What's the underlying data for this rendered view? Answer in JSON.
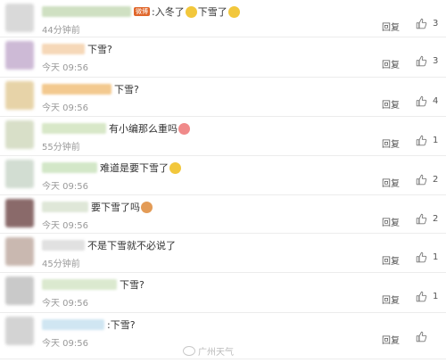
{
  "comments": [
    {
      "segments": [
        ":入冬了",
        "下雪了"
      ],
      "time": "44分钟前",
      "reply": "回复",
      "likes": "3",
      "badge": "微博",
      "emojis": [
        "#f2c73c",
        "#f2c73c"
      ],
      "uname_w": 100,
      "uname_col": "#cfe0c2",
      "avatar_col": "#d9d9d9"
    },
    {
      "segments": [
        "下雪?"
      ],
      "time": "今天 09:56",
      "reply": "回复",
      "likes": "3",
      "emojis": [],
      "uname_w": 48,
      "uname_col": "#f6d8b8",
      "avatar_col": "#cdbad6"
    },
    {
      "segments": [
        "下雪?"
      ],
      "time": "今天 09:56",
      "reply": "回复",
      "likes": "4",
      "emojis": [],
      "uname_w": 78,
      "uname_col": "#f3c98f",
      "avatar_col": "#e7d3a8"
    },
    {
      "segments": [
        "有小编那么重吗"
      ],
      "time": "55分钟前",
      "reply": "回复",
      "likes": "1",
      "emojis": [
        "#f08a8a"
      ],
      "uname_w": 72,
      "uname_col": "#d8e8c8",
      "avatar_col": "#d8dfc8"
    },
    {
      "segments": [
        "难道是要下雪了"
      ],
      "time": "今天 09:56",
      "reply": "回复",
      "likes": "2",
      "emojis": [
        "#f2c73c"
      ],
      "uname_w": 62,
      "uname_col": "#d3e7c8",
      "avatar_col": "#d2ddd2"
    },
    {
      "segments": [
        "要下雪了吗"
      ],
      "time": "今天 09:56",
      "reply": "回复",
      "likes": "2",
      "emojis": [
        "#e39b56"
      ],
      "uname_w": 52,
      "uname_col": "#dfe7d8",
      "avatar_col": "#8a6a6a"
    },
    {
      "segments": [
        "不是下雪就不必说了"
      ],
      "time": "45分钟前",
      "reply": "回复",
      "likes": "1",
      "emojis": [],
      "uname_w": 48,
      "uname_col": "#e1e1e1",
      "avatar_col": "#c9b8b0"
    },
    {
      "segments": [
        "下雪?"
      ],
      "time": "今天 09:56",
      "reply": "回复",
      "likes": "1",
      "emojis": [],
      "uname_w": 84,
      "uname_col": "#dbe9cf",
      "avatar_col": "#c9c9c9"
    },
    {
      "segments": [
        ":下雪?"
      ],
      "time": "今天 09:56",
      "reply": "回复",
      "likes": "",
      "emojis": [],
      "uname_w": 70,
      "uname_col": "#d0e6f2",
      "avatar_col": "#d3d3d3"
    }
  ],
  "watermark": "广州天气"
}
